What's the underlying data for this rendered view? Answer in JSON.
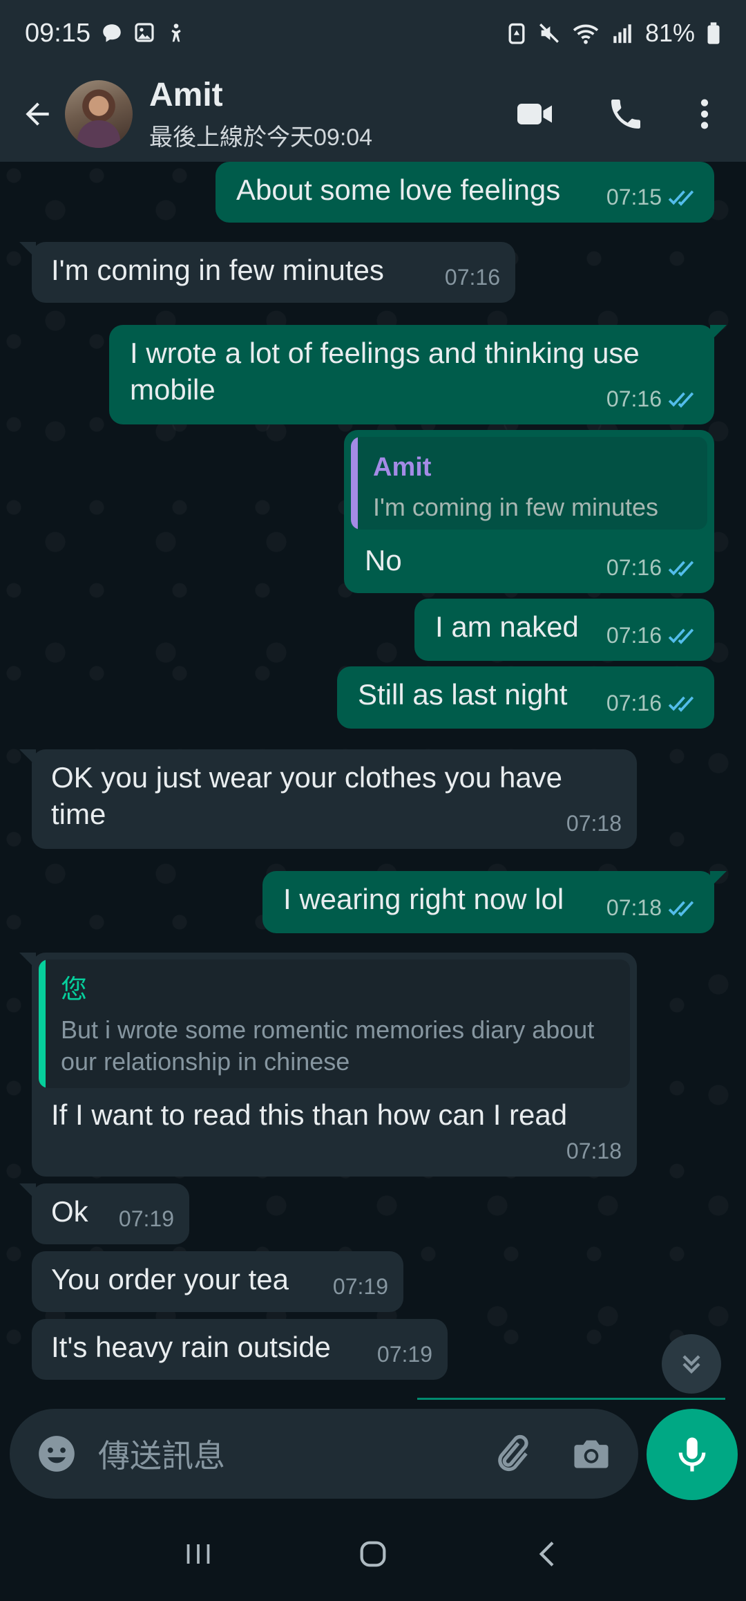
{
  "status_bar": {
    "time": "09:15",
    "battery": "81%"
  },
  "header": {
    "contact_name": "Amit",
    "last_seen": "最後上線於今天09:04"
  },
  "colors": {
    "outgoing_bubble": "#005c4b",
    "incoming_bubble": "#1f2c34",
    "accent": "#00a884",
    "read_ticks": "#53bdeb"
  },
  "messages": [
    {
      "dir": "out",
      "text": "About some love feelings",
      "time": "07:15",
      "status": "read"
    },
    {
      "dir": "in",
      "text": "I'm coming in few minutes",
      "time": "07:16"
    },
    {
      "dir": "out",
      "text": "I wrote a lot of feelings and thinking use mobile",
      "time": "07:16",
      "status": "read"
    },
    {
      "dir": "out",
      "text": "No",
      "time": "07:16",
      "status": "read",
      "quote": {
        "author": "Amit",
        "text": "I'm coming in few minutes"
      }
    },
    {
      "dir": "out",
      "text": "I am naked",
      "time": "07:16",
      "status": "read"
    },
    {
      "dir": "out",
      "text": "Still as last night",
      "time": "07:16",
      "status": "read"
    },
    {
      "dir": "in",
      "text": "OK you just wear your clothes you have time",
      "time": "07:18"
    },
    {
      "dir": "out",
      "text": "I wearing right now lol",
      "time": "07:18",
      "status": "read"
    },
    {
      "dir": "in",
      "text": "If I want to read this than how can I read",
      "time": "07:18",
      "quote": {
        "author": "您",
        "text": "But i wrote some romentic memories diary about our relationship in chinese"
      }
    },
    {
      "dir": "in",
      "text": "Ok",
      "time": "07:19"
    },
    {
      "dir": "in",
      "text": "You order your tea",
      "time": "07:19"
    },
    {
      "dir": "in",
      "text": "It's heavy rain outside",
      "time": "07:19"
    }
  ],
  "composer": {
    "placeholder": "傳送訊息"
  }
}
